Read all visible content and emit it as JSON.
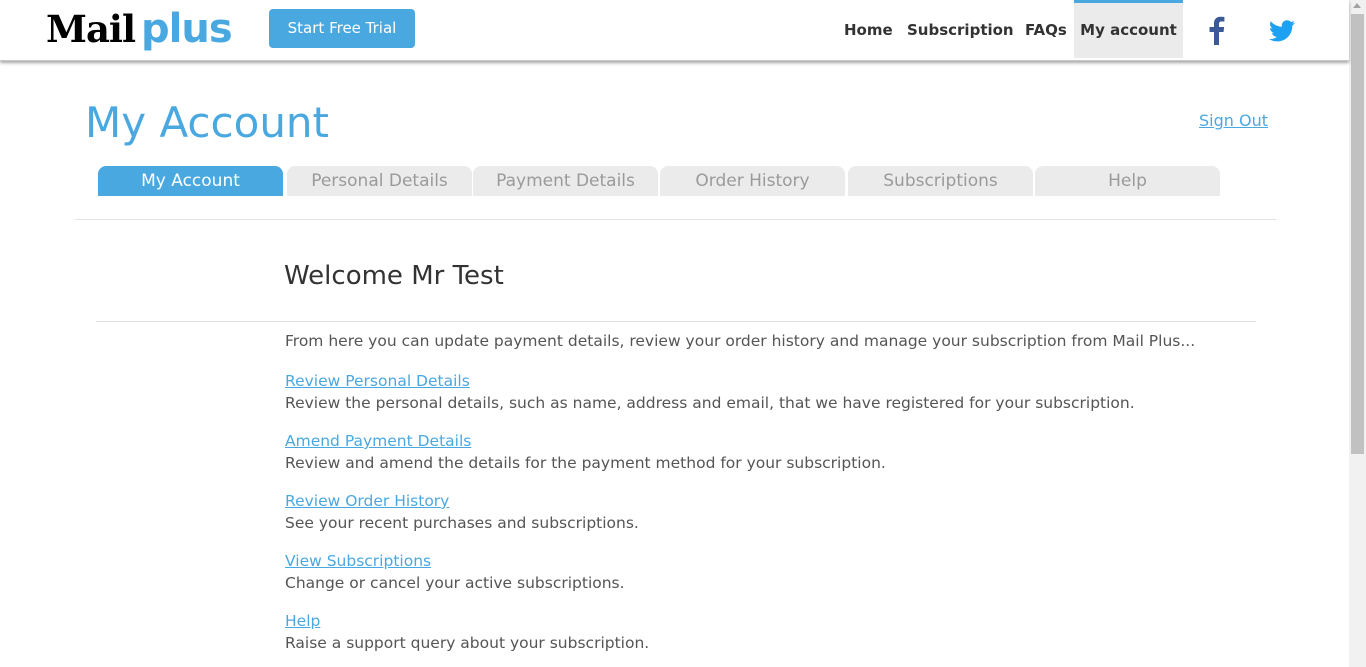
{
  "header": {
    "logo_mail": "Mail",
    "logo_plus": "plus",
    "trial_button": "Start Free Trial",
    "nav": [
      "Home",
      "Subscription",
      "FAQs",
      "My account"
    ],
    "social_icons": [
      "facebook-icon",
      "twitter-icon"
    ]
  },
  "main": {
    "title": "My Account",
    "sign_out": "Sign Out",
    "tabs": [
      "My Account",
      "Personal Details",
      "Payment Details",
      "Order History",
      "Subscriptions",
      "Help"
    ],
    "active_tab": "My Account",
    "welcome": "Welcome Mr Test",
    "intro": "From here you can update payment details, review your order history and manage your subscription from Mail Plus...",
    "links": [
      {
        "label": "Review Personal Details",
        "desc": "Review the personal details, such as name, address and email, that we have registered for your subscription."
      },
      {
        "label": "Amend Payment Details",
        "desc": "Review and amend the details for the payment method for your subscription."
      },
      {
        "label": "Review Order History",
        "desc": "See your recent purchases and subscriptions."
      },
      {
        "label": "View Subscriptions",
        "desc": "Change or cancel your active subscriptions."
      },
      {
        "label": "Help",
        "desc": "Raise a support query about your subscription."
      }
    ]
  },
  "colors": {
    "accent": "#4aa8e0",
    "tab_inactive_bg": "#ebebeb",
    "facebook": "#3b5998",
    "twitter": "#1da1f2"
  }
}
